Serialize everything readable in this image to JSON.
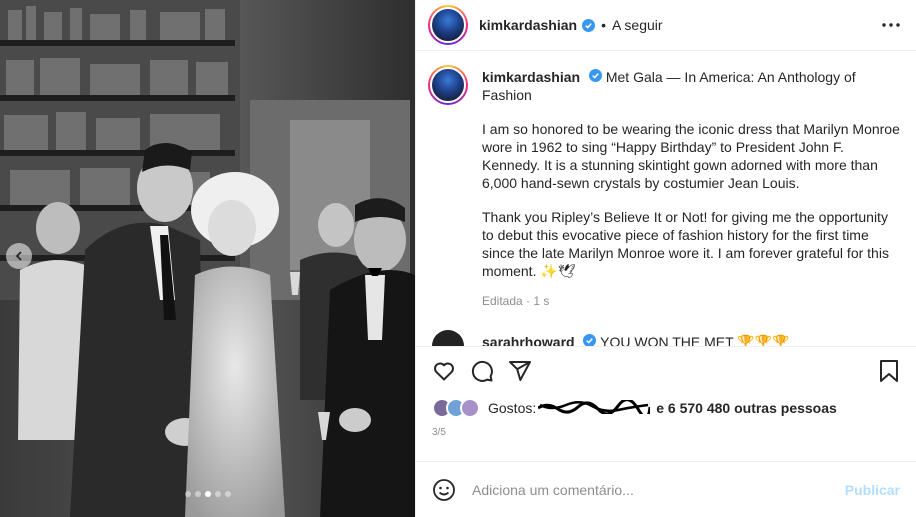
{
  "post": {
    "author": "kimkardashian",
    "follow_label": "A seguir",
    "separator": "•",
    "caption_location": "Met Gala — In America: An Anthology of Fashion",
    "caption_p1": "I am so honored to be wearing the iconic dress that Marilyn Monroe wore in 1962 to sing “Happy Birthday” to President John F. Kennedy. It is a stunning skintight gown adorned with more than 6,000 hand-sewn crystals by costumier Jean Louis.",
    "caption_p2": "Thank you Ripley’s Believe It or Not! for giving me the opportunity to debut this evocative piece of fashion history for the first time since the late Marilyn Monroe wore it. I am forever grateful for this moment. ✨🕊",
    "edited_label": "Editada",
    "edited_time": "1 s",
    "edited_dot": "·"
  },
  "comment": {
    "author": "sarahrhoward",
    "text": "YOU WON THE MET 🏆🏆🏆"
  },
  "likes": {
    "prefix": "Gostos:",
    "suffix": "e 6 570 480 outras pessoas"
  },
  "carousel": {
    "counter": "3/5",
    "total": 5,
    "current": 3
  },
  "add_comment": {
    "placeholder": "Adiciona um comentário...",
    "publish_label": "Publicar"
  },
  "colors": {
    "verified": "#3897f0",
    "publish_disabled": "#b2dffc",
    "muted": "#8e8e8e"
  },
  "icons": [
    "chevron-left-icon",
    "verified-icon",
    "more-options-icon",
    "heart-icon",
    "comment-icon",
    "share-icon",
    "bookmark-icon",
    "emoji-icon"
  ]
}
